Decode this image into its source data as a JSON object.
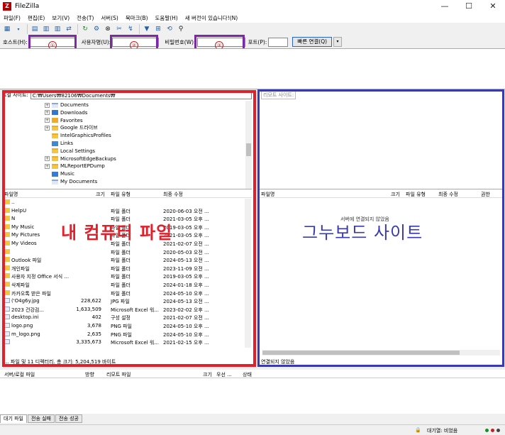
{
  "window": {
    "title": "FileZilla",
    "minimize": "—",
    "maximize": "☐",
    "close": "✕"
  },
  "menu": [
    "파일(F)",
    "편집(E)",
    "보기(V)",
    "전송(T)",
    "서버(S)",
    "북마크(B)",
    "도움말(H)",
    "새 버전이 있습니다!(N)"
  ],
  "quickconnect": {
    "host_label": "호스트(H):",
    "user_label": "사용자명(U):",
    "pass_label": "비밀번호(W):",
    "port_label": "포트(P):",
    "connect_button": "빠른 연결(Q)",
    "dropdown": "▾",
    "n1": "①",
    "n2": "②",
    "n3": "③"
  },
  "colors": {
    "red_box": "#e0202a",
    "blue_box": "#3a3ab0",
    "purple_box": "#7a2aa5"
  },
  "local": {
    "site_label": "로컬 사이트:",
    "path": "C:₩Users₩82106₩Documents₩",
    "tree": [
      {
        "label": "Documents",
        "expand": "+",
        "icon": "doc"
      },
      {
        "label": "Downloads",
        "expand": "+",
        "icon": "download"
      },
      {
        "label": "Favorites",
        "expand": "+",
        "icon": "star"
      },
      {
        "label": "Google 드라이브",
        "expand": "+",
        "icon": "folder"
      },
      {
        "label": "IntelGraphicsProfiles",
        "expand": "",
        "icon": "folder"
      },
      {
        "label": "Links",
        "expand": "",
        "icon": "link"
      },
      {
        "label": "Local Settings",
        "expand": "",
        "icon": "folder"
      },
      {
        "label": "MicrosoftEdgeBackups",
        "expand": "+",
        "icon": "folder"
      },
      {
        "label": "MLReportEPDump",
        "expand": "+",
        "icon": "folder"
      },
      {
        "label": "Music",
        "expand": "",
        "icon": "music"
      },
      {
        "label": "My Documents",
        "expand": "",
        "icon": "doc"
      }
    ],
    "headers": {
      "name": "파일명",
      "size": "크기",
      "type": "파일 유형",
      "modified": "최종 수정"
    },
    "files": [
      {
        "name": "..",
        "size": "",
        "type": "",
        "modified": ""
      },
      {
        "name": "HelpU",
        "size": "",
        "type": "파일 폴더",
        "modified": "2020-06-03 오전 ..."
      },
      {
        "name": "N",
        "size": "",
        "type": "파일 폴더",
        "modified": "2021-03-05 오후 ..."
      },
      {
        "name": "My Music",
        "size": "",
        "type": "파일 폴더",
        "modified": "2019-03-05 오후 ..."
      },
      {
        "name": "My Pictures",
        "size": "",
        "type": "파일 폴더",
        "modified": "2021-03-05 오후 ..."
      },
      {
        "name": "My Videos",
        "size": "",
        "type": "파일 폴더",
        "modified": "2021-02-07 오전 ..."
      },
      {
        "name": "",
        "size": "",
        "type": "파일 폴더",
        "modified": "2020-05-03 오전 ..."
      },
      {
        "name": "Outlook 파일",
        "size": "",
        "type": "파일 폴더",
        "modified": "2024-05-13 오전 ..."
      },
      {
        "name": "개인파일",
        "size": "",
        "type": "파일 폴더",
        "modified": "2023-11-09 오전 ..."
      },
      {
        "name": "사용자 지정 Office 서식 ...",
        "size": "",
        "type": "파일 폴더",
        "modified": "2019-03-05 오후 ..."
      },
      {
        "name": "삭제파일",
        "size": "",
        "type": "파일 폴더",
        "modified": "2024-01-18 오후 ..."
      },
      {
        "name": "카카오톡 받은 파일",
        "size": "",
        "type": "파일 폴더",
        "modified": "2024-05-10 오후 ..."
      },
      {
        "name": "('O4g6y.jpg",
        "size": "228,622",
        "type": "JPG 파일",
        "modified": "2024-05-13 오전 ..."
      },
      {
        "name": "2023         건강검...",
        "size": "1,633,509",
        "type": "Microsoft Excel 워...",
        "modified": "2023-02-02 오후 ..."
      },
      {
        "name": "desktop.ini",
        "size": "402",
        "type": "구성 설정",
        "modified": "2021-02-07 오전 ..."
      },
      {
        "name": "logo.png",
        "size": "3,678",
        "type": "PNG 파일",
        "modified": "2024-05-10 오후 ..."
      },
      {
        "name": "m_logo.png",
        "size": "2,635",
        "type": "PNG 파일",
        "modified": "2024-05-10 오후 ..."
      },
      {
        "name": "",
        "size": "3,335,673",
        "type": "Microsoft Excel 워...",
        "modified": "2021-02-15 오후 ..."
      }
    ],
    "status": "... 파일 및 11 디렉터리. 총 크기: 5,204,519 바이트",
    "overlay": "내 컴퓨터 파일"
  },
  "remote": {
    "site_label": "리모트 사이트:",
    "headers": {
      "name": "파일명",
      "size": "크기",
      "type": "파일 유형",
      "modified": "최종 수정",
      "perm": "권한"
    },
    "empty": "서버에 연결되지 않았음",
    "status": "연결되지 않았음",
    "overlay": "그누보드 사이트"
  },
  "queue": {
    "headers": {
      "server": "서버/로컬 파일",
      "dir": "방향",
      "remote": "리모트 파일",
      "size": "크기",
      "priority": "우선 ...",
      "state": "상태"
    },
    "tabs": [
      "대기 파일",
      "전송 실패",
      "전송 성공"
    ],
    "status": "대기열: 비었음"
  }
}
